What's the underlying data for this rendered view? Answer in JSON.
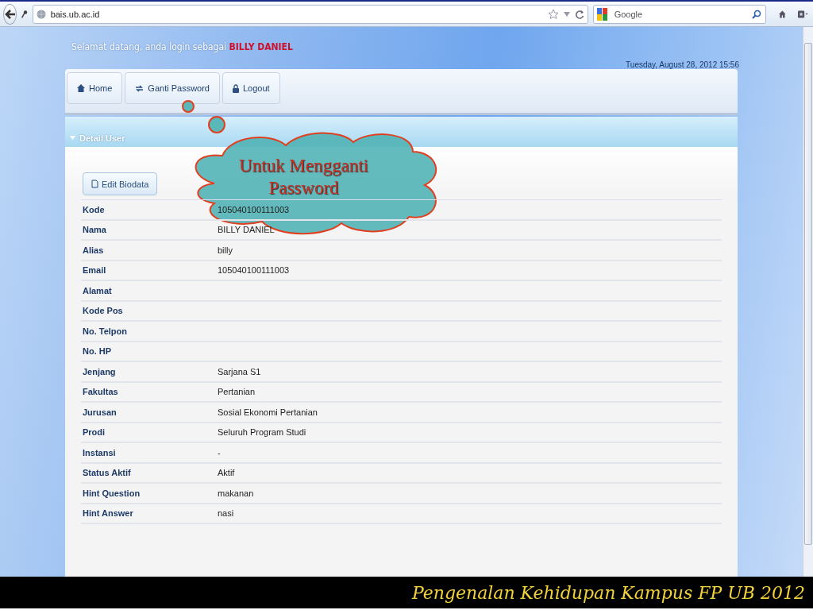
{
  "browser": {
    "url": "bais.ub.ac.id",
    "search_placeholder": "Google"
  },
  "page": {
    "welcome": "Selamat datang, anda login sebagai",
    "user": "BILLY DANIEL",
    "datetime": "Tuesday, August 28, 2012 15:56",
    "nav": [
      {
        "label": "Home"
      },
      {
        "label": "Ganti Password"
      },
      {
        "label": "Logout"
      }
    ],
    "section_title": "Detail User",
    "edit_button": "Edit Biodata",
    "fields": [
      {
        "label": "Kode",
        "value": "105040100111003"
      },
      {
        "label": "Nama",
        "value": "BILLY DANIEL"
      },
      {
        "label": "Alias",
        "value": "billy"
      },
      {
        "label": "Email",
        "value": "105040100111003"
      },
      {
        "label": "Alamat"
      },
      {
        "label": "Kode Pos"
      },
      {
        "label": "No. Telpon"
      },
      {
        "label": "No. HP"
      },
      {
        "label": "Jenjang",
        "value": "Sarjana S1"
      },
      {
        "label": "Fakultas",
        "value": "Pertanian"
      },
      {
        "label": "Jurusan",
        "value": "Sosial Ekonomi Pertanian"
      },
      {
        "label": "Prodi",
        "value": "Seluruh Program Studi"
      },
      {
        "label": "Instansi",
        "value": "-"
      },
      {
        "label": "Status Aktif",
        "value": "Aktif"
      },
      {
        "label": "Hint Question",
        "value": "makanan"
      },
      {
        "label": "Hint Answer",
        "value": "nasi"
      }
    ]
  },
  "callout": {
    "text": "Untuk Mengganti Password"
  },
  "footer": "Pengenalan Kehidupan Kampus FP UB 2012"
}
